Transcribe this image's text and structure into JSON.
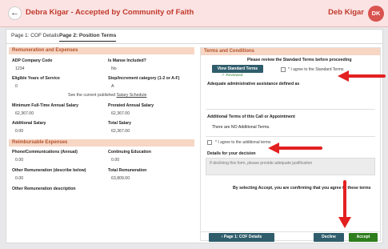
{
  "header": {
    "title": "Debra Kigar - Accepted by Community of Faith",
    "user_name": "Deb Kigar",
    "avatar_initials": "DK",
    "back_icon": "arrow-left-icon"
  },
  "tabs": [
    {
      "label": "Page 1: COF Details",
      "active": false
    },
    {
      "label": "Page 2: Position Terms",
      "active": true
    }
  ],
  "remuneration": {
    "section_title": "Remuneration and Expenses",
    "adp_label": "ADP Company Code",
    "adp_value": "1234",
    "manse_label": "Is Manse Included?",
    "manse_value": "No",
    "eligible_label": "Eligible Years of Service",
    "eligible_value": "0",
    "step_label": "Step/increment category (1-2 or A-F)",
    "step_value": "A",
    "schedule_text": "See the current published",
    "schedule_link": "Salary Schedule",
    "min_salary_label": "Minimum Full-Time Annual Salary",
    "min_salary_value": "62,367.00",
    "prorated_label": "Prorated Annual Salary",
    "prorated_value": "62,367.00",
    "additional_label": "Additional Salary",
    "additional_value": "0.00",
    "total_salary_label": "Total Salary",
    "total_salary_value": "62,367.00"
  },
  "reimbursable": {
    "section_title": "Reimbursable Expenses",
    "phone_label": "Phone/Communications (Annual)",
    "phone_value": "0.00",
    "continuing_label": "Continuing Education",
    "continuing_value": "0.00",
    "other_label": "Other Remuneration (describe below)",
    "other_value": "0.00",
    "total_remun_label": "Total Remuneration",
    "total_remun_value": "63,809.00",
    "other_desc_label": "Other Remuneration description"
  },
  "terms": {
    "section_title": "Terms and Conditions",
    "review_prompt": "Please review the Standard Terms before proceeding",
    "view_button": "View Standard Terms",
    "reviewed_text": "✓ Reviewed",
    "agree_standard": "* I agree to the Standard Terms",
    "adequate_label": "Adequate administrative assistance defined as",
    "additional_terms_label": "Additional Terms of this Call or Appointment",
    "no_additional": "There are NO Additional Terms.",
    "agree_additional": "* I agree to the additional terms",
    "details_label": "Details for your decision",
    "details_placeholder": "If declining this form, please provide adequate justification",
    "confirm_text": "By selecting Accept, you are confirming that you agree to these terms"
  },
  "footer": {
    "page1_button": "‹  Page 1: COF Details",
    "decline_button": "Decline",
    "accept_button": "Accept"
  },
  "colors": {
    "header_bg": "#fbe3e3",
    "title_red": "#c0392b",
    "section_bg": "#f7d6c4",
    "teal_button": "#2f5d6c",
    "accept_green": "#2e7d1d",
    "annotation_red": "#e32020"
  }
}
